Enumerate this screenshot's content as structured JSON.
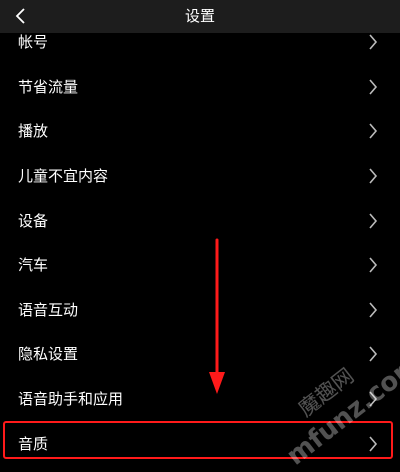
{
  "header": {
    "title": "设置",
    "back_icon": "chevron-left-icon"
  },
  "settings": {
    "items": [
      {
        "label": "帐号"
      },
      {
        "label": "节省流量"
      },
      {
        "label": "播放"
      },
      {
        "label": "儿童不宜内容"
      },
      {
        "label": "设备"
      },
      {
        "label": "汽车"
      },
      {
        "label": "语音互动"
      },
      {
        "label": "隐私设置"
      },
      {
        "label": "语音助手和应用"
      },
      {
        "label": "音质"
      }
    ]
  },
  "annotation": {
    "arrow_color": "#ff1a1a",
    "highlight_color": "#ff1a1a",
    "watermark_brand": "魔趣网",
    "watermark_domain": "mfunz.com"
  }
}
